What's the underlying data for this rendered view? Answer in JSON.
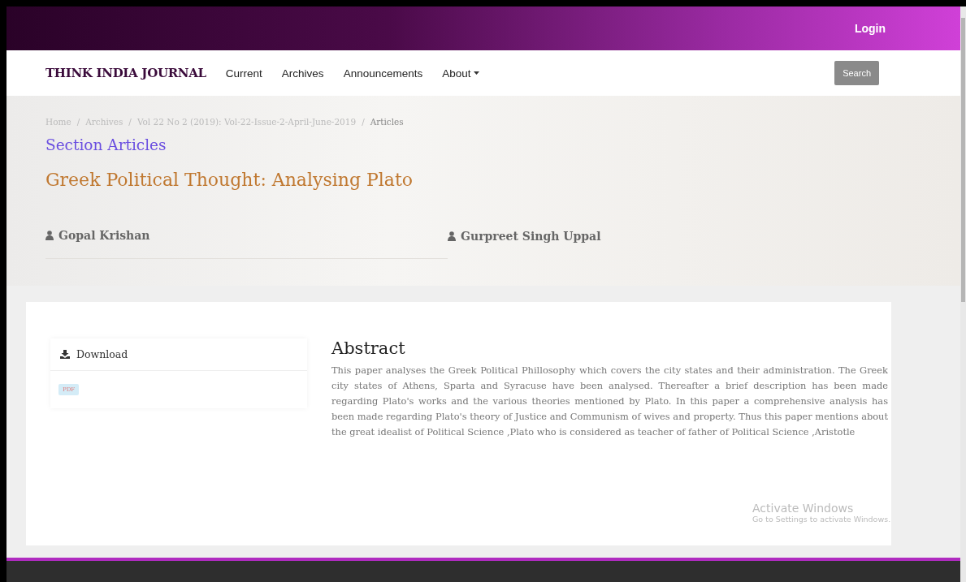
{
  "topbar": {
    "login": "Login"
  },
  "nav": {
    "brand": "THINK INDIA JOURNAL",
    "items": [
      {
        "label": "Current",
        "kind": "link"
      },
      {
        "label": "Archives",
        "kind": "link"
      },
      {
        "label": "Announcements",
        "kind": "link"
      },
      {
        "label": "About",
        "kind": "dropdown"
      }
    ],
    "search": "Search"
  },
  "breadcrumb_separator": "/",
  "breadcrumb": [
    {
      "label": "Home",
      "current": false
    },
    {
      "label": "Archives",
      "current": false
    },
    {
      "label": "Vol 22 No 2 (2019): Vol-22-Issue-2-April-June-2019",
      "current": false
    },
    {
      "label": "Articles",
      "current": true
    }
  ],
  "section": "Section Articles",
  "title": "Greek Political Thought: Analysing Plato",
  "authors": [
    "Gopal Krishan",
    "Gurpreet Singh Uppal"
  ],
  "download": {
    "heading": "Download",
    "files": [
      "PDF"
    ]
  },
  "abstract": {
    "heading": "Abstract",
    "text": "This paper analyses the Greek Political Phillosophy which covers the city states and their administration. The Greek city states of Athens, Sparta and Syracuse have been analysed. Thereafter  a brief description has been made regarding Plato's works and the various theories mentioned by Plato. In this paper a comprehensive analysis has been made regarding Plato's theory of Justice and Communism of wives and property. Thus this paper mentions about the great idealist of Political Science ,Plato who is considered as teacher of father of Political Science ,Aristotle"
  },
  "os_notice": {
    "title": "Activate Windows",
    "text": "Go to Settings to activate Windows."
  }
}
